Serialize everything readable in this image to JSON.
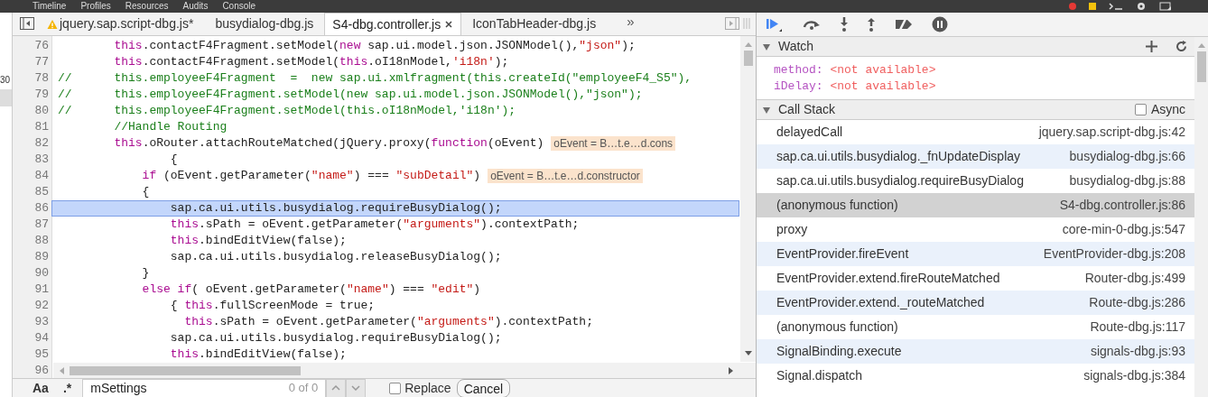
{
  "devtools_menu": [
    "Timeline",
    "Profiles",
    "Resources",
    "Audits",
    "Console"
  ],
  "navigator_strip": {
    "text": "30"
  },
  "editor_tabs": [
    {
      "label": "jquery.sap.script-dbg.js*",
      "selected": false,
      "warning": true
    },
    {
      "label": "busydialog-dbg.js",
      "selected": false,
      "warning": false
    },
    {
      "label": "S4-dbg.controller.js",
      "selected": true,
      "warning": false
    },
    {
      "label": "IconTabHeader-dbg.js",
      "selected": false,
      "warning": false
    }
  ],
  "tabs_overflow": "»",
  "code_lines": [
    {
      "number": "76",
      "current": false,
      "tokens": [
        {
          "kind": "keyword",
          "text": "        this"
        },
        {
          "kind": "plain",
          "text": ".contactF4Fragment.setModel("
        },
        {
          "kind": "keyword",
          "text": "new"
        },
        {
          "kind": "plain",
          "text": " sap.ui.model.json.JSONModel(),"
        },
        {
          "kind": "string",
          "text": "\"json\""
        },
        {
          "kind": "plain",
          "text": ");"
        }
      ]
    },
    {
      "number": "77",
      "current": false,
      "tokens": [
        {
          "kind": "keyword",
          "text": "        this"
        },
        {
          "kind": "plain",
          "text": ".contactF4Fragment.setModel("
        },
        {
          "kind": "keyword",
          "text": "this"
        },
        {
          "kind": "plain",
          "text": ".oI18nModel,"
        },
        {
          "kind": "string",
          "text": "'i18n'"
        },
        {
          "kind": "plain",
          "text": ");"
        }
      ]
    },
    {
      "number": "78",
      "current": false,
      "tokens": [
        {
          "kind": "comment",
          "text": "//      this.employeeF4Fragment  =  new sap.ui.xmlfragment(this.createId(\"employeeF4_S5\"),"
        }
      ]
    },
    {
      "number": "79",
      "current": false,
      "tokens": [
        {
          "kind": "comment",
          "text": "//      this.employeeF4Fragment.setModel(new sap.ui.model.json.JSONModel(),\"json\");"
        }
      ]
    },
    {
      "number": "80",
      "current": false,
      "tokens": [
        {
          "kind": "comment",
          "text": "//      this.employeeF4Fragment.setModel(this.oI18nModel,'i18n');"
        }
      ]
    },
    {
      "number": "81",
      "current": false,
      "tokens": [
        {
          "kind": "comment",
          "text": "        //Handle Routing"
        }
      ]
    },
    {
      "number": "82",
      "current": false,
      "tokens": [
        {
          "kind": "keyword",
          "text": "        this"
        },
        {
          "kind": "plain",
          "text": ".oRouter.attachRouteMatched(jQuery.proxy("
        },
        {
          "kind": "keyword",
          "text": "function"
        },
        {
          "kind": "plain",
          "text": "(oEvent)"
        }
      ],
      "inline_value": "oEvent = B…t.e…d.cons"
    },
    {
      "number": "83",
      "current": false,
      "tokens": [
        {
          "kind": "plain",
          "text": "                {"
        }
      ]
    },
    {
      "number": "84",
      "current": false,
      "tokens": [
        {
          "kind": "keyword",
          "text": "            if"
        },
        {
          "kind": "plain",
          "text": " (oEvent.getParameter("
        },
        {
          "kind": "string",
          "text": "\"name\""
        },
        {
          "kind": "plain",
          "text": ") === "
        },
        {
          "kind": "string",
          "text": "\"subDetail\""
        },
        {
          "kind": "plain",
          "text": ")"
        }
      ],
      "inline_value": "oEvent = B…t.e…d.constructor"
    },
    {
      "number": "85",
      "current": false,
      "tokens": [
        {
          "kind": "plain",
          "text": "            {"
        }
      ]
    },
    {
      "number": "86",
      "current": true,
      "tokens": [
        {
          "kind": "plain",
          "text": "                sap.ca.ui.utils.busydialog.requireBusyDialog();"
        }
      ]
    },
    {
      "number": "87",
      "current": false,
      "tokens": [
        {
          "kind": "keyword",
          "text": "                this"
        },
        {
          "kind": "plain",
          "text": ".sPath = oEvent.getParameter("
        },
        {
          "kind": "string",
          "text": "\"arguments\""
        },
        {
          "kind": "plain",
          "text": ").contextPath;"
        }
      ]
    },
    {
      "number": "88",
      "current": false,
      "tokens": [
        {
          "kind": "keyword",
          "text": "                this"
        },
        {
          "kind": "plain",
          "text": ".bindEditView(false);"
        }
      ]
    },
    {
      "number": "89",
      "current": false,
      "tokens": [
        {
          "kind": "plain",
          "text": "                sap.ca.ui.utils.busydialog.releaseBusyDialog();"
        }
      ]
    },
    {
      "number": "90",
      "current": false,
      "tokens": [
        {
          "kind": "plain",
          "text": "            }"
        }
      ]
    },
    {
      "number": "91",
      "current": false,
      "tokens": [
        {
          "kind": "keyword",
          "text": "            else if"
        },
        {
          "kind": "plain",
          "text": "( oEvent.getParameter("
        },
        {
          "kind": "string",
          "text": "\"name\""
        },
        {
          "kind": "plain",
          "text": ") === "
        },
        {
          "kind": "string",
          "text": "\"edit\""
        },
        {
          "kind": "plain",
          "text": ")"
        }
      ]
    },
    {
      "number": "92",
      "current": false,
      "tokens": [
        {
          "kind": "plain",
          "text": "                { "
        },
        {
          "kind": "keyword",
          "text": "this"
        },
        {
          "kind": "plain",
          "text": ".fullScreenMode = true;"
        }
      ]
    },
    {
      "number": "93",
      "current": false,
      "tokens": [
        {
          "kind": "keyword",
          "text": "                  this"
        },
        {
          "kind": "plain",
          "text": ".sPath = oEvent.getParameter("
        },
        {
          "kind": "string",
          "text": "\"arguments\""
        },
        {
          "kind": "plain",
          "text": ").contextPath;"
        }
      ]
    },
    {
      "number": "94",
      "current": false,
      "tokens": [
        {
          "kind": "plain",
          "text": "                sap.ca.ui.utils.busydialog.requireBusyDialog();"
        }
      ]
    },
    {
      "number": "95",
      "current": false,
      "tokens": [
        {
          "kind": "keyword",
          "text": "                this"
        },
        {
          "kind": "plain",
          "text": ".bindEditView(false);"
        }
      ]
    },
    {
      "number": "96",
      "current": false
    }
  ],
  "search_bar": {
    "case_toggle": "Aa",
    "regex_toggle": ".*",
    "value": "mSettings",
    "match_count": "0 of 0",
    "replace": {
      "label": "Replace",
      "checked": false
    },
    "cancel": "Cancel"
  },
  "watch": {
    "title": "Watch",
    "expanded": true,
    "items": [
      {
        "name": "method:",
        "value": "<not available>"
      },
      {
        "name": "iDelay:",
        "value": "<not available>"
      }
    ]
  },
  "call_stack": {
    "title": "Call Stack",
    "expanded": true,
    "async": {
      "label": "Async",
      "checked": false
    },
    "frames": [
      {
        "function": "delayedCall",
        "location": "jquery.sap.script-dbg.js:42",
        "selected": false,
        "tinted": false
      },
      {
        "function": "sap.ca.ui.utils.busydialog._fnUpdateDisplay",
        "location": "busydialog-dbg.js:66",
        "selected": false,
        "tinted": true
      },
      {
        "function": "sap.ca.ui.utils.busydialog.requireBusyDialog",
        "location": "busydialog-dbg.js:88",
        "selected": false,
        "tinted": false
      },
      {
        "function": "(anonymous function)",
        "location": "S4-dbg.controller.js:86",
        "selected": true,
        "tinted": false
      },
      {
        "function": "proxy",
        "location": "core-min-0-dbg.js:547",
        "selected": false,
        "tinted": false
      },
      {
        "function": "EventProvider.fireEvent",
        "location": "EventProvider-dbg.js:208",
        "selected": false,
        "tinted": true
      },
      {
        "function": "EventProvider.extend.fireRouteMatched",
        "location": "Router-dbg.js:499",
        "selected": false,
        "tinted": false
      },
      {
        "function": "EventProvider.extend._routeMatched",
        "location": "Route-dbg.js:286",
        "selected": false,
        "tinted": true
      },
      {
        "function": "(anonymous function)",
        "location": "Route-dbg.js:117",
        "selected": false,
        "tinted": false
      },
      {
        "function": "SignalBinding.execute",
        "location": "signals-dbg.js:93",
        "selected": false,
        "tinted": true
      },
      {
        "function": "Signal.dispatch",
        "location": "signals-dbg.js:384",
        "selected": false,
        "tinted": false
      }
    ]
  }
}
